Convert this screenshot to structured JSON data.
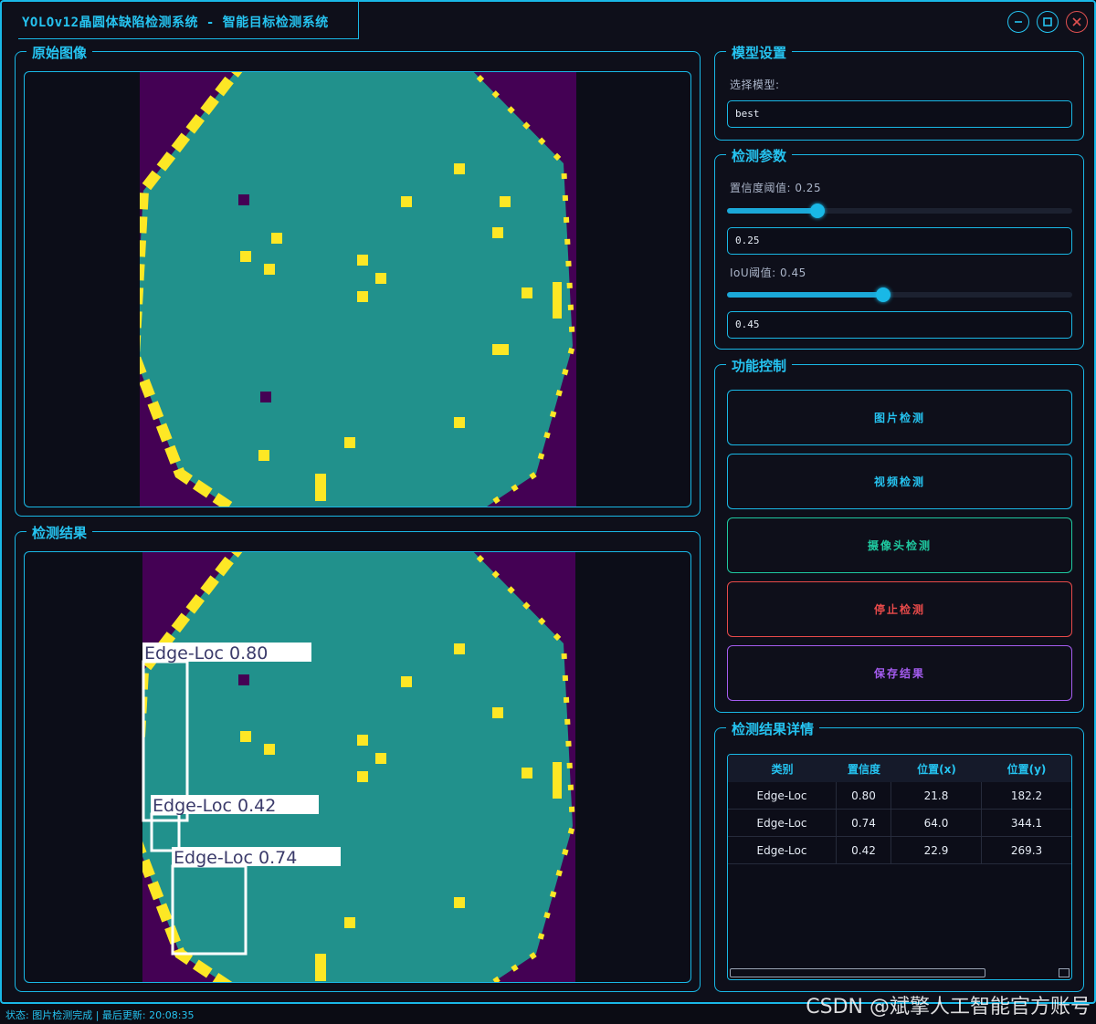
{
  "window": {
    "title": "YOLOv12晶圆体缺陷检测系统 - 智能目标检测系统",
    "minimize_icon": "minus-circle-icon",
    "maximize_icon": "square-circle-icon",
    "close_icon": "x-circle-icon"
  },
  "original_panel": {
    "title": "原始图像"
  },
  "result_panel": {
    "title": "检测结果",
    "boxes": [
      {
        "label": "Edge-Loc 0.80"
      },
      {
        "label": "Edge-Loc 0.42"
      },
      {
        "label": "Edge-Loc 0.74"
      }
    ]
  },
  "model_settings": {
    "title": "模型设置",
    "select_label": "选择模型:",
    "selected_model": "best"
  },
  "detection_params": {
    "title": "检测参数",
    "confidence_label": "置信度阈值: 0.25",
    "confidence_value": "0.25",
    "confidence": 0.25,
    "iou_label": "IoU阈值: 0.45",
    "iou_value": "0.45",
    "iou": 0.45
  },
  "controls": {
    "title": "功能控制",
    "image_detect": "图片检测",
    "video_detect": "视频检测",
    "camera_detect": "摄像头检测",
    "stop_detect": "停止检测",
    "save_result": "保存结果"
  },
  "results_table": {
    "title": "检测结果详情",
    "headers": [
      "类别",
      "置信度",
      "位置(x)",
      "位置(y)"
    ],
    "rows": [
      [
        "Edge-Loc",
        "0.80",
        "21.8",
        "182.2"
      ],
      [
        "Edge-Loc",
        "0.74",
        "64.0",
        "344.1"
      ],
      [
        "Edge-Loc",
        "0.42",
        "22.9",
        "269.3"
      ]
    ]
  },
  "status": {
    "text": "状态: 图片检测完成 | 最后更新: 20:08:35"
  },
  "watermark": "CSDN @斌擎人工智能官方账号",
  "colors": {
    "accent": "#19b8e6",
    "background": "#0e0f1a",
    "wafer_bg": "#440154",
    "wafer_body": "#21918c",
    "wafer_defect": "#fde725",
    "camera_button": "#1fc9a0",
    "stop_button": "#e84a4a",
    "save_button": "#a55cf0"
  }
}
